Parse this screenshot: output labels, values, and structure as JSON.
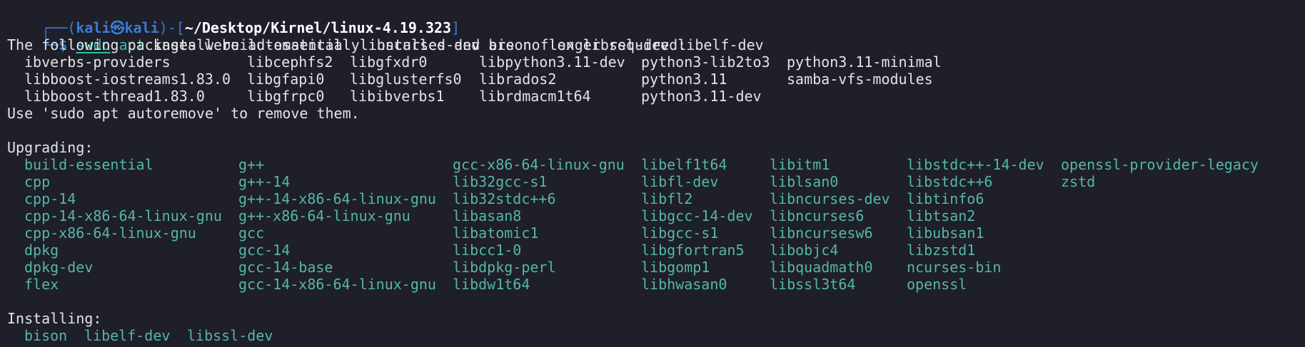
{
  "prompt": {
    "box_top": "┌──(",
    "user": "kali",
    "at_symbol": "㉿",
    "host": "kali",
    "mid": ")-[",
    "path": "~/Desktop/Kirnel/linux-4.19.323",
    "close": "]",
    "box_bottom": "└─",
    "dollar": "$",
    "cmd_sudo": "sudo",
    "cmd_apt": "apt",
    "cmd_rest": " install build-essential libncurses-dev bison flex libssl-dev libelf-dev"
  },
  "auto_installed": {
    "header": "The following packages were automatically installed and are no longer required:",
    "rows": [
      [
        "ibverbs-providers",
        "libcephfs2",
        "libgfxdr0",
        "libpython3.11-dev",
        "python3-lib2to3",
        "python3.11-minimal"
      ],
      [
        "libboost-iostreams1.83.0",
        "libgfapi0",
        "libglusterfs0",
        "librados2",
        "python3.11",
        "samba-vfs-modules"
      ],
      [
        "libboost-thread1.83.0",
        "libgfrpc0",
        "libibverbs1",
        "librdmacm1t64",
        "python3.11-dev",
        ""
      ]
    ],
    "hint": "Use 'sudo apt autoremove' to remove them."
  },
  "upgrading": {
    "header": "Upgrading:",
    "columns": [
      [
        "build-essential",
        "cpp",
        "cpp-14",
        "cpp-14-x86-64-linux-gnu",
        "cpp-x86-64-linux-gnu",
        "dpkg",
        "dpkg-dev",
        "flex"
      ],
      [
        "g++",
        "g++-14",
        "g++-14-x86-64-linux-gnu",
        "g++-x86-64-linux-gnu",
        "gcc",
        "gcc-14",
        "gcc-14-base",
        "gcc-14-x86-64-linux-gnu"
      ],
      [
        "gcc-x86-64-linux-gnu",
        "lib32gcc-s1",
        "lib32stdc++6",
        "libasan8",
        "libatomic1",
        "libcc1-0",
        "libdpkg-perl",
        "libdw1t64"
      ],
      [
        "libelf1t64",
        "libfl-dev",
        "libfl2",
        "libgcc-14-dev",
        "libgcc-s1",
        "libgfortran5",
        "libgomp1",
        "libhwasan0"
      ],
      [
        "libitm1",
        "liblsan0",
        "libncurses-dev",
        "libncurses6",
        "libncursesw6",
        "libobjc4",
        "libquadmath0",
        "libssl3t64"
      ],
      [
        "libstdc++-14-dev",
        "libstdc++6",
        "libtinfo6",
        "libtsan2",
        "libubsan1",
        "libzstd1",
        "ncurses-bin",
        "openssl"
      ],
      [
        "openssl-provider-legacy",
        "zstd",
        "",
        "",
        "",
        "",
        "",
        ""
      ]
    ]
  },
  "installing": {
    "header": "Installing:",
    "items": [
      "bison",
      "libelf-dev",
      "libssl-dev"
    ]
  },
  "colors": {
    "background": "#1e1f29",
    "prompt_blue": "#3a7bd5",
    "package_teal": "#56b6a8",
    "command_green": "#2bc0a6",
    "text": "#e4e4e7"
  }
}
